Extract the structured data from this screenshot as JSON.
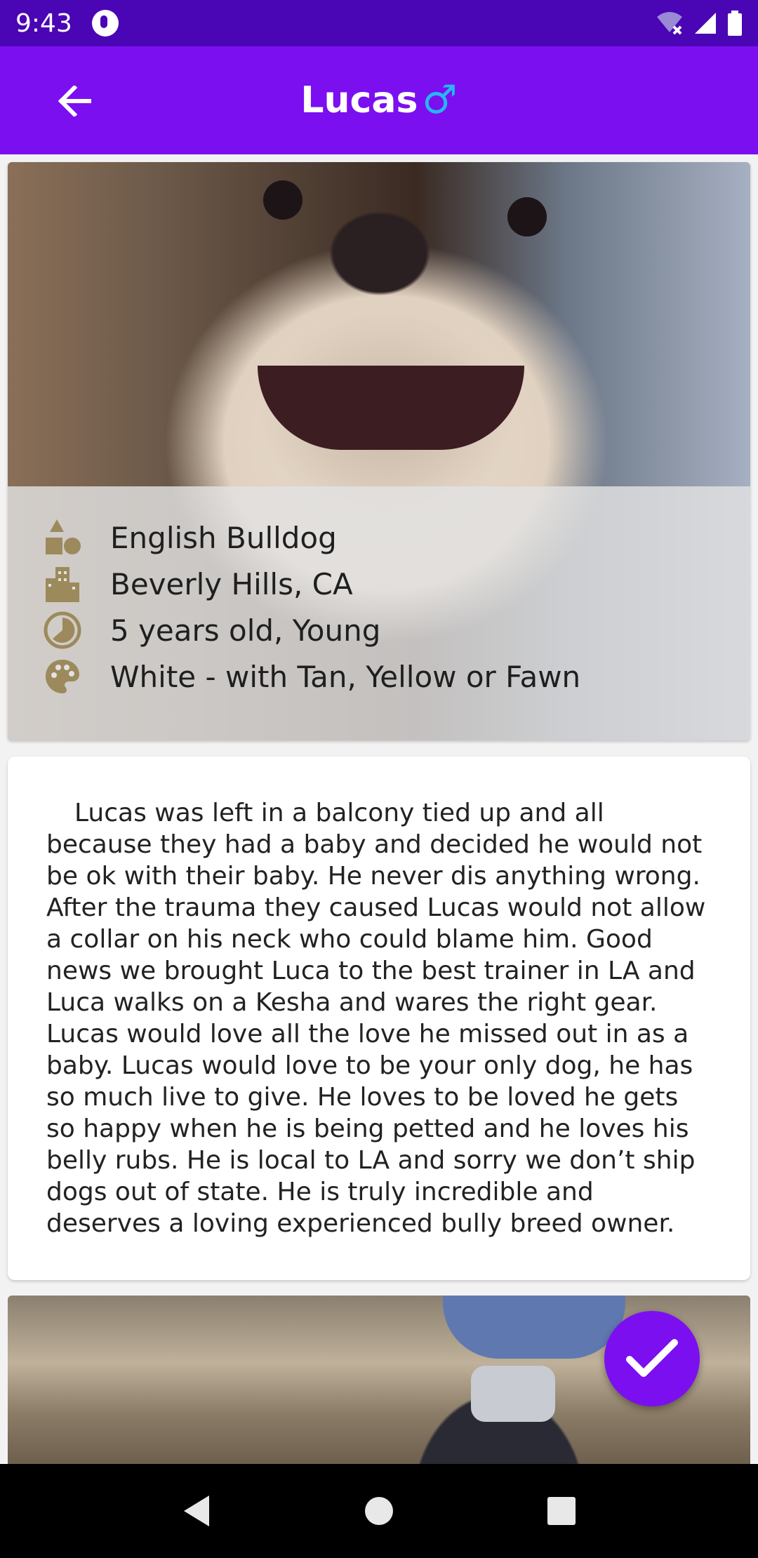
{
  "status_bar": {
    "time": "9:43"
  },
  "app_bar": {
    "title": "Lucas",
    "gender_symbol": "♂",
    "back_icon": "arrow-left-icon"
  },
  "pet": {
    "breed": "English Bulldog",
    "location": "Beverly Hills, CA",
    "age": "5 years old, Young",
    "colors": "White - with Tan, Yellow or Fawn"
  },
  "description": "Lucas was left in a balcony tied up and all because they had a baby and decided he would not be ok with their baby. He never dis anything wrong. After the trauma they caused Lucas would not allow a collar on his neck who could blame him. Good news we brought Luca to the best trainer in LA and Luca walks on a Kesha and wares the right gear. Lucas would love all the love he missed out in as a baby. Lucas would love to be your only dog, he has so much live to give. He loves to be loved he gets so happy when he is being petted and he loves his belly rubs. He is local to LA and sorry we don’t ship dogs out of state. He is truly incredible and deserves a loving experienced bully breed owner.",
  "colors": {
    "status_bar": "#4a05b4",
    "app_bar": "#7b0ff0",
    "gender_icon": "#27b6f6",
    "info_icon": "#9c8a5c"
  }
}
